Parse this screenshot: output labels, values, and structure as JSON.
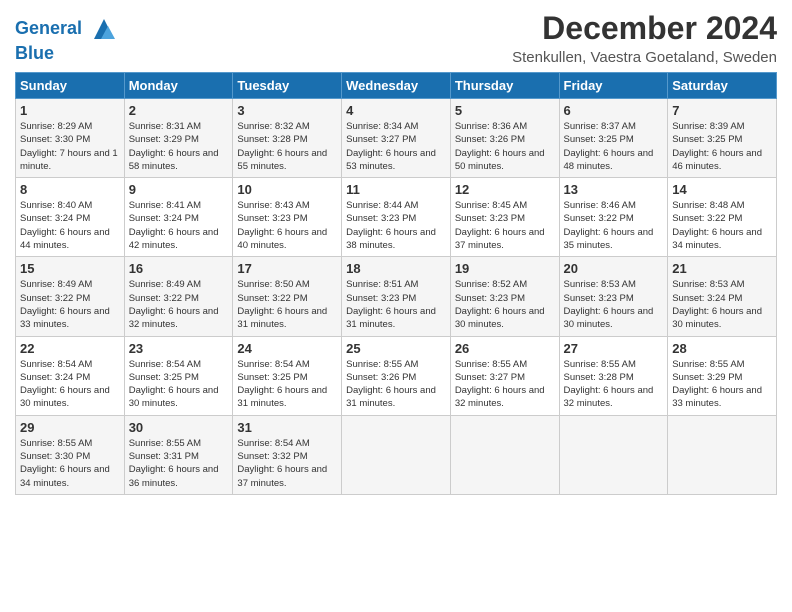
{
  "logo": {
    "line1": "General",
    "line2": "Blue"
  },
  "title": "December 2024",
  "location": "Stenkullen, Vaestra Goetaland, Sweden",
  "days_of_week": [
    "Sunday",
    "Monday",
    "Tuesday",
    "Wednesday",
    "Thursday",
    "Friday",
    "Saturday"
  ],
  "weeks": [
    [
      {
        "day": 1,
        "sunrise": "8:29 AM",
        "sunset": "3:30 PM",
        "daylight": "7 hours and 1 minute."
      },
      {
        "day": 2,
        "sunrise": "8:31 AM",
        "sunset": "3:29 PM",
        "daylight": "6 hours and 58 minutes."
      },
      {
        "day": 3,
        "sunrise": "8:32 AM",
        "sunset": "3:28 PM",
        "daylight": "6 hours and 55 minutes."
      },
      {
        "day": 4,
        "sunrise": "8:34 AM",
        "sunset": "3:27 PM",
        "daylight": "6 hours and 53 minutes."
      },
      {
        "day": 5,
        "sunrise": "8:36 AM",
        "sunset": "3:26 PM",
        "daylight": "6 hours and 50 minutes."
      },
      {
        "day": 6,
        "sunrise": "8:37 AM",
        "sunset": "3:25 PM",
        "daylight": "6 hours and 48 minutes."
      },
      {
        "day": 7,
        "sunrise": "8:39 AM",
        "sunset": "3:25 PM",
        "daylight": "6 hours and 46 minutes."
      }
    ],
    [
      {
        "day": 8,
        "sunrise": "8:40 AM",
        "sunset": "3:24 PM",
        "daylight": "6 hours and 44 minutes."
      },
      {
        "day": 9,
        "sunrise": "8:41 AM",
        "sunset": "3:24 PM",
        "daylight": "6 hours and 42 minutes."
      },
      {
        "day": 10,
        "sunrise": "8:43 AM",
        "sunset": "3:23 PM",
        "daylight": "6 hours and 40 minutes."
      },
      {
        "day": 11,
        "sunrise": "8:44 AM",
        "sunset": "3:23 PM",
        "daylight": "6 hours and 38 minutes."
      },
      {
        "day": 12,
        "sunrise": "8:45 AM",
        "sunset": "3:23 PM",
        "daylight": "6 hours and 37 minutes."
      },
      {
        "day": 13,
        "sunrise": "8:46 AM",
        "sunset": "3:22 PM",
        "daylight": "6 hours and 35 minutes."
      },
      {
        "day": 14,
        "sunrise": "8:48 AM",
        "sunset": "3:22 PM",
        "daylight": "6 hours and 34 minutes."
      }
    ],
    [
      {
        "day": 15,
        "sunrise": "8:49 AM",
        "sunset": "3:22 PM",
        "daylight": "6 hours and 33 minutes."
      },
      {
        "day": 16,
        "sunrise": "8:49 AM",
        "sunset": "3:22 PM",
        "daylight": "6 hours and 32 minutes."
      },
      {
        "day": 17,
        "sunrise": "8:50 AM",
        "sunset": "3:22 PM",
        "daylight": "6 hours and 31 minutes."
      },
      {
        "day": 18,
        "sunrise": "8:51 AM",
        "sunset": "3:23 PM",
        "daylight": "6 hours and 31 minutes."
      },
      {
        "day": 19,
        "sunrise": "8:52 AM",
        "sunset": "3:23 PM",
        "daylight": "6 hours and 30 minutes."
      },
      {
        "day": 20,
        "sunrise": "8:53 AM",
        "sunset": "3:23 PM",
        "daylight": "6 hours and 30 minutes."
      },
      {
        "day": 21,
        "sunrise": "8:53 AM",
        "sunset": "3:24 PM",
        "daylight": "6 hours and 30 minutes."
      }
    ],
    [
      {
        "day": 22,
        "sunrise": "8:54 AM",
        "sunset": "3:24 PM",
        "daylight": "6 hours and 30 minutes."
      },
      {
        "day": 23,
        "sunrise": "8:54 AM",
        "sunset": "3:25 PM",
        "daylight": "6 hours and 30 minutes."
      },
      {
        "day": 24,
        "sunrise": "8:54 AM",
        "sunset": "3:25 PM",
        "daylight": "6 hours and 31 minutes."
      },
      {
        "day": 25,
        "sunrise": "8:55 AM",
        "sunset": "3:26 PM",
        "daylight": "6 hours and 31 minutes."
      },
      {
        "day": 26,
        "sunrise": "8:55 AM",
        "sunset": "3:27 PM",
        "daylight": "6 hours and 32 minutes."
      },
      {
        "day": 27,
        "sunrise": "8:55 AM",
        "sunset": "3:28 PM",
        "daylight": "6 hours and 32 minutes."
      },
      {
        "day": 28,
        "sunrise": "8:55 AM",
        "sunset": "3:29 PM",
        "daylight": "6 hours and 33 minutes."
      }
    ],
    [
      {
        "day": 29,
        "sunrise": "8:55 AM",
        "sunset": "3:30 PM",
        "daylight": "6 hours and 34 minutes."
      },
      {
        "day": 30,
        "sunrise": "8:55 AM",
        "sunset": "3:31 PM",
        "daylight": "6 hours and 36 minutes."
      },
      {
        "day": 31,
        "sunrise": "8:54 AM",
        "sunset": "3:32 PM",
        "daylight": "6 hours and 37 minutes."
      },
      null,
      null,
      null,
      null
    ]
  ]
}
